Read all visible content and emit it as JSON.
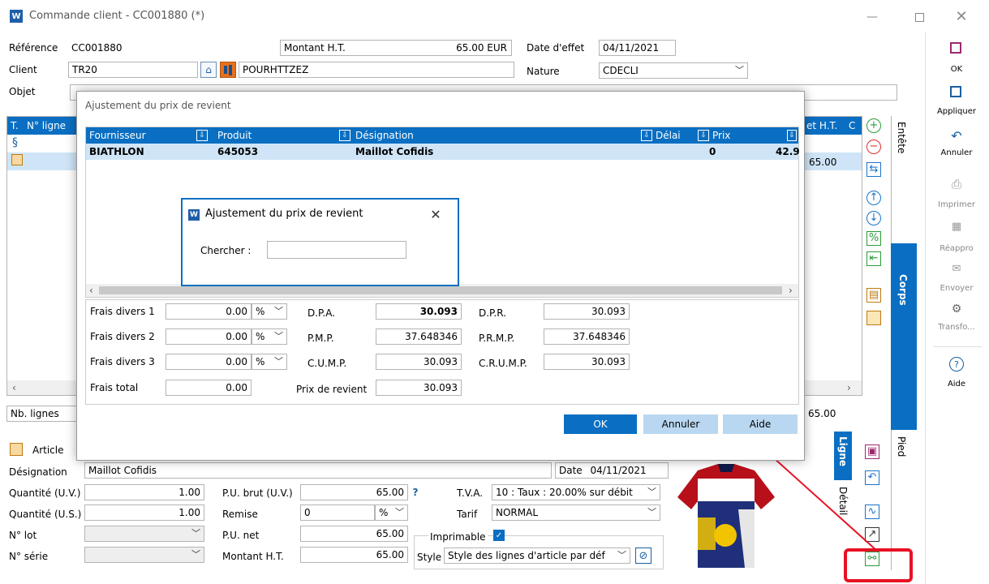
{
  "window": {
    "title": "Commande client - CC001880 (*)"
  },
  "header": {
    "reference_label": "Référence",
    "reference": "CC001880",
    "montant_label": "Montant H.T.",
    "montant": "65.00 EUR",
    "date_effet_label": "Date d'effet",
    "date_effet": "04/11/2021",
    "client_label": "Client",
    "client_code": "TR20",
    "client_name": "POURHTTZEZ",
    "nature_label": "Nature",
    "nature": "CDECLI",
    "objet_label": "Objet"
  },
  "grid": {
    "col_t": "T.",
    "col_n": "N° ligne",
    "col_ht": "et H.T.",
    "col_c": "C",
    "row_value": "65.00",
    "nb_lignes_label": "Nb. lignes",
    "nb_total": "65.00"
  },
  "line_panel": {
    "article_label": "Article",
    "designation_label": "Désignation",
    "designation": "Maillot Cofidis",
    "date_label": "Date",
    "date": "04/11/2021",
    "qty_uv_label": "Quantité (U.V.)",
    "qty_uv": "1.00",
    "qty_us_label": "Quantité (U.S.)",
    "qty_us": "1.00",
    "lot_label": "N° lot",
    "serie_label": "N° série",
    "pu_brut_label": "P.U. brut (U.V.)",
    "pu_brut": "65.00",
    "remise_label": "Remise",
    "remise": "0",
    "remise_unit": "%",
    "pu_net_label": "P.U. net",
    "pu_net": "65.00",
    "montant_label": "Montant H.T.",
    "montant": "65.00",
    "tva_label": "T.V.A.",
    "tva": "10 : Taux : 20.00% sur débit",
    "tarif_label": "Tarif",
    "tarif": "NORMAL",
    "imprimable_label": "Imprimable",
    "style_label": "Style",
    "style": "Style des lignes d'article par déf",
    "help_mark": "?"
  },
  "side_tabs": {
    "entete": "Entête",
    "corps": "Corps",
    "pied": "Pied",
    "ligne": "Ligne",
    "detail": "Détail"
  },
  "right_toolbar": {
    "ok": "OK",
    "appliquer": "Appliquer",
    "annuler": "Annuler",
    "imprimer": "Imprimer",
    "reappro": "Réappro",
    "envoyer": "Envoyer",
    "transfo": "Transfo...",
    "aide": "Aide"
  },
  "cost_dialog": {
    "title": "Ajustement du prix de revient",
    "columns": [
      "Fournisseur",
      "Produit",
      "Désignation",
      "Délai",
      "Prix"
    ],
    "row": {
      "fournisseur": "BIATHLON",
      "produit": "645053",
      "designation": "Maillot Cofidis",
      "delai": "0",
      "prix": "42.9"
    },
    "frais1_label": "Frais divers 1",
    "frais1": "0.00",
    "frais2_label": "Frais divers 2",
    "frais2": "0.00",
    "frais3_label": "Frais divers 3",
    "frais3": "0.00",
    "frais_unit": "%",
    "frais_total_label": "Frais total",
    "frais_total": "0.00",
    "dpa_label": "D.P.A.",
    "dpa": "30.093",
    "pmp_label": "P.M.P.",
    "pmp": "37.648346",
    "cump_label": "C.U.M.P.",
    "cump": "30.093",
    "prix_revient_label": "Prix de revient",
    "prix_revient": "30.093",
    "dpr_label": "D.P.R.",
    "dpr": "30.093",
    "prmp_label": "P.R.M.P.",
    "prmp": "37.648346",
    "crump_label": "C.R.U.M.P.",
    "crump": "30.093",
    "ok": "OK",
    "annuler": "Annuler",
    "aide": "Aide"
  },
  "search_dialog": {
    "title": "Ajustement du prix de revient",
    "chercher_label": "Chercher :",
    "value": ""
  },
  "colors": {
    "accent": "#0a6fc2",
    "selected_row": "#cfe5f7",
    "annotation": "#e81123"
  }
}
